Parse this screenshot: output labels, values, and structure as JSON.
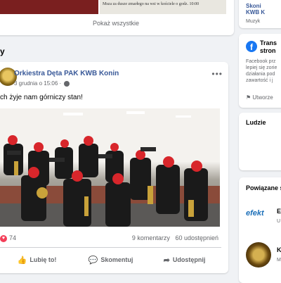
{
  "top": {
    "notice_text": "Msza za dusze zmarłego na wsi w kościele o godz. 10:00",
    "show_all": "Pokaż wszystkie"
  },
  "feed": {
    "heading_fragment": "y"
  },
  "post": {
    "page_name": "Orkiestra Dęta PAK KWB Konin",
    "time": "3 grudnia o 15:06 ·",
    "text": "ch żyje nam górniczy stan!",
    "reactions_count": "74",
    "comments": "9 komentarzy",
    "shares": "60 udostępnień",
    "actions": {
      "like": "Lubię to!",
      "comment": "Skomentuj",
      "share": "Udostępnij"
    }
  },
  "sidebar": {
    "card1_line1": "Skoni",
    "card1_line2": "KWB K",
    "card1_line3": "Muzyk",
    "card2_title_1": "Trans",
    "card2_title_2": "stron",
    "card2_text": [
      "Facebook prz",
      "lepiej się zorie",
      "działania pod",
      "zawartość i j"
    ],
    "card2_create": "Utworze",
    "card3_title": "Ludzie",
    "card4_title": "Powiązane s",
    "card4_item1_logo": "efekt",
    "card4_item1_name": "E",
    "card4_item1_sub": "U",
    "card4_item2_name": "K",
    "card4_item2_sub": "M"
  },
  "colors": {
    "accent": "#385898",
    "reaction_heart": "#f33e58",
    "facebook_blue": "#1877f2"
  }
}
